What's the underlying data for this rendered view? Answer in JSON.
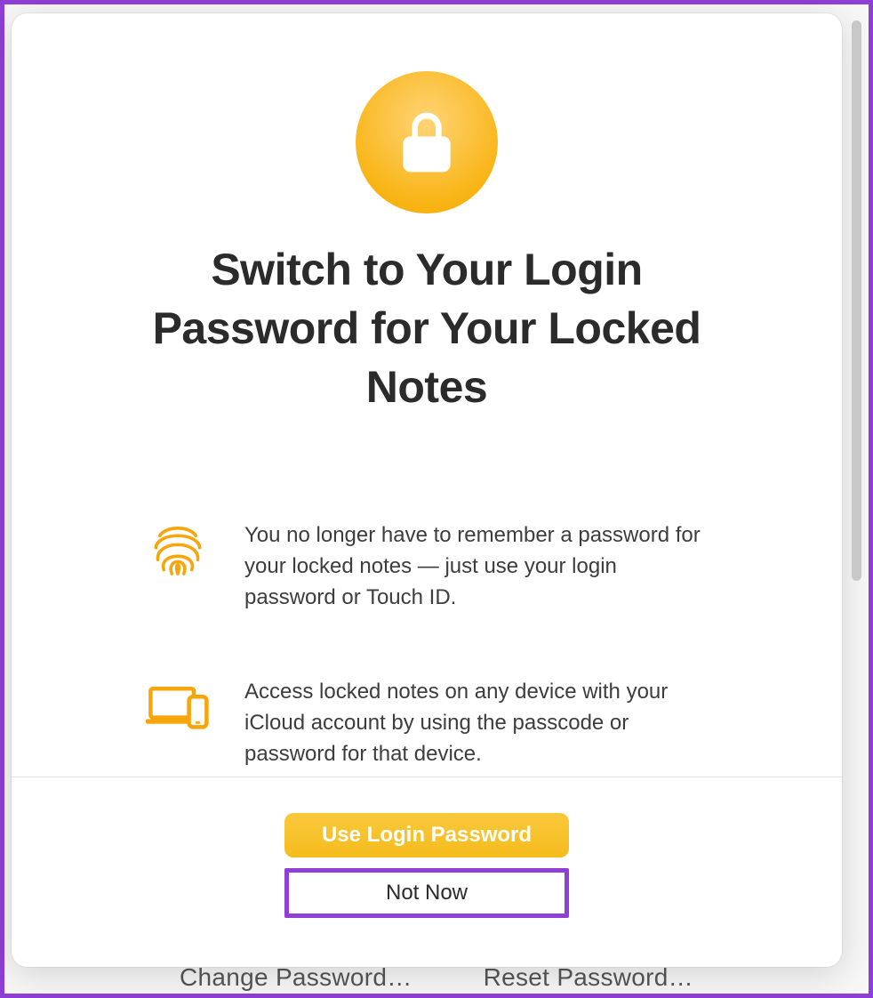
{
  "dialog": {
    "title": "Switch to Your Login Password for Your Locked Notes",
    "features": [
      {
        "icon": "fingerprint-icon",
        "text": "You no longer have to remember a password for your locked notes — just use your login password or Touch ID."
      },
      {
        "icon": "devices-icon",
        "text": "Access locked notes on any device with your iCloud account by using the passcode or password for that device."
      }
    ],
    "primary_button": "Use Login Password",
    "secondary_button": "Not Now"
  },
  "background": {
    "button_left": "Change Password…",
    "button_right": "Reset Password…"
  },
  "colors": {
    "accent": "#f6bc1f",
    "highlight": "#8f3fd6"
  }
}
